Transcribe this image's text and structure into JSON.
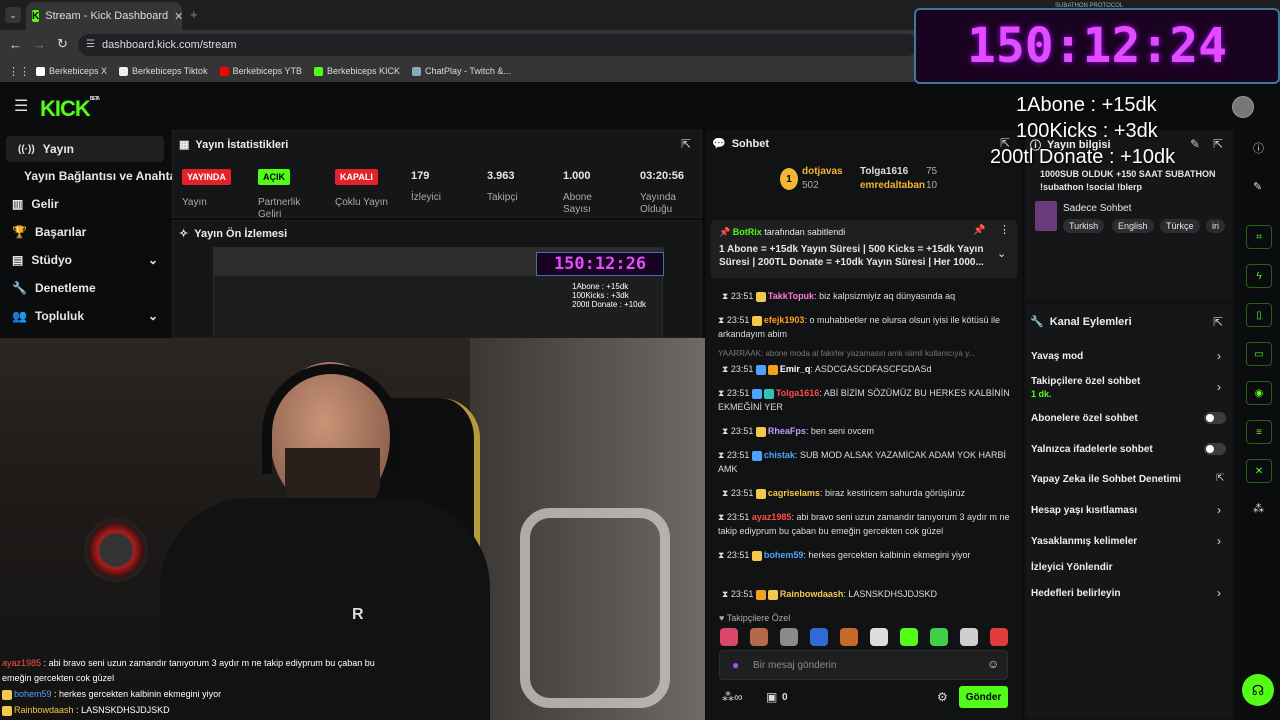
{
  "browser": {
    "tab_title": "Stream - Kick Dashboard",
    "url": "dashboard.kick.com/stream",
    "bookmarks": [
      {
        "label": "Berkebiceps X",
        "color": "#ffffff"
      },
      {
        "label": "Berkebiceps Tiktok",
        "color": "#ffffff"
      },
      {
        "label": "Berkebiceps YTB",
        "color": "#ff0000"
      },
      {
        "label": "Berkebiceps KICK",
        "color": "#53fc18"
      },
      {
        "label": "ChatPlay - Twitch &...",
        "color": "#9ab"
      }
    ]
  },
  "brand": {
    "logo": "KICK",
    "beta": "BETA",
    "accent": "#53fc18"
  },
  "sidebar": {
    "items": [
      {
        "label": "Yayın",
        "icon": "broadcast-icon"
      },
      {
        "label": "Yayın Bağlantısı ve Anahtarı",
        "icon": ""
      },
      {
        "label": "Gelir",
        "icon": "chart-icon"
      },
      {
        "label": "Başarılar",
        "icon": "trophy-icon"
      },
      {
        "label": "Stüdyo",
        "icon": "studio-icon"
      },
      {
        "label": "Denetleme",
        "icon": "wrench-icon"
      },
      {
        "label": "Topluluk",
        "icon": "community-icon"
      }
    ]
  },
  "stats": {
    "title": "Yayın İstatistikleri",
    "live_badge": "YAYINDA",
    "live_label": "Yayın",
    "partner_badge": "AÇIK",
    "partner_label": "Partnerlik Geliri",
    "multi_badge": "KAPALI",
    "multi_label": "Çoklu Yayın",
    "viewers_value": "179",
    "viewers_label": "İzleyici",
    "followers_value": "3.963",
    "followers_label": "Takipçi",
    "subs_value": "1.000",
    "subs_label": "Abone Sayısı",
    "uptime_value": "03:20:56",
    "uptime_label": "Yayında Olduğu"
  },
  "preview": {
    "title": "Yayın Ön İzlemesi"
  },
  "chat": {
    "title": "Sohbet",
    "gifter1_name": "dotjavas",
    "gifter1_count": "502",
    "gifter2_name": "Tolga1616",
    "gifter2_count": "75",
    "gifter3_name": "emredaltaban",
    "gifter3_count": "10",
    "pinned_by": "BotRix",
    "pinned_suffix": "tarafından sabitlendi",
    "pinned_text": "1 Abone = +15dk Yayın Süresi | 500 Kicks = +15dk Yayın Süresi | 200TL Donate = +10dk Yayın Süresi | Her 1000...",
    "messages": [
      {
        "time": "23:51",
        "user": "TakkTopuk",
        "color": "#ff7ad9",
        "text": "biz kalpsizmiyiz aq dünyasında aq"
      },
      {
        "time": "23:51",
        "user": "efejk1903",
        "color": "#ff9f1a",
        "text": "o muhabbetler ne olursa olsun iyisi ile kötüsü ile arkandayım abim"
      },
      {
        "time": "",
        "user": "YAARRAAK",
        "color": "#888888",
        "text": "abone moda al fakirler yazamasın amk isimli kullanıcıya y..."
      },
      {
        "time": "23:51",
        "user": "Emir_q",
        "color": "#ffffff",
        "text": "ASDCGASCDFASCFGDASd"
      },
      {
        "time": "23:51",
        "user": "Tolga1616",
        "color": "#ff4d4d",
        "text": "ABİ BİZİM SÖZÜMÜZ BU HERKES KALBİNİN EKMEĞİNİ YER"
      },
      {
        "time": "23:51",
        "user": "RheaFps",
        "color": "#c59aff",
        "text": "ben seni ovcem"
      },
      {
        "time": "23:51",
        "user": "chistak",
        "color": "#4ea3ff",
        "text": "SUB MOD ALSAK YAZAMİCAK ADAM YOK HARBİ AMK"
      },
      {
        "time": "23:51",
        "user": "cagriselams",
        "color": "#f2c94c",
        "text": "biraz kestiricem sahurda görüşürüz"
      },
      {
        "time": "23:51",
        "user": "ayaz1985",
        "color": "#ff4d4d",
        "text": "abi bravo seni uzun zamandır tanıyorum 3 aydır m ne takip ediyprum bu çaban bu emeğin gercekten cok güzel"
      },
      {
        "time": "23:51",
        "user": "bohem59",
        "color": "#4ea3ff",
        "text": "herkes gercekten kalbinin ekmegini yiyor"
      },
      {
        "time": "23:51",
        "user": "Rainbowdaash",
        "color": "#f2c94c",
        "text": "LASNSKDHSJDJSKD"
      }
    ],
    "followers_only": "Takipçilere Özel",
    "input_placeholder": "Bir mesaj gönderin",
    "kicks_count": "0",
    "send_label": "Gönder"
  },
  "info": {
    "title": "Yayın bilgisi",
    "stream_title": "1000SUB OLDUK +150 SAAT SUBATHON !subathon !social !blerp",
    "category": "Sadece Sohbet",
    "tags": [
      "Turkish",
      "English",
      "Türkçe",
      "iri"
    ]
  },
  "actions": {
    "title": "Kanal Eylemleri",
    "items": [
      {
        "label": "Yavaş mod",
        "sub": ""
      },
      {
        "label": "Takipçilere özel sohbet",
        "sub": "1 dk."
      },
      {
        "label": "Abonelere özel sohbet",
        "sub": ""
      },
      {
        "label": "Yalnızca ifadelerle sohbet",
        "sub": ""
      },
      {
        "label": "Yapay Zeka ile Sohbet Denetimi",
        "sub": ""
      },
      {
        "label": "Hesap yaşı kısıtlaması",
        "sub": ""
      },
      {
        "label": "Yasaklanmış kelimeler",
        "sub": ""
      },
      {
        "label": "İzleyici Yönlendir",
        "sub": ""
      },
      {
        "label": "Hedefleri belirleyin",
        "sub": ""
      }
    ]
  },
  "overlay": {
    "timer": "150:12:24",
    "timer_caption": "SUBATHON PROTOCOL",
    "line1": "1Abone : +15dk",
    "line2": "100Kicks : +3dk",
    "line3": "200tl Donate : +10dk"
  },
  "video_chat": [
    {
      "user": "ayaz1985",
      "color": "#ff4d4d",
      "text": "abi bravo seni uzun zamandır tanıyorum 3 aydır m ne takip ediyprum bu çaban bu emeğin gercekten cok güzel"
    },
    {
      "user": "bohem59",
      "color": "#4ea3ff",
      "text": "herkes gercekten kalbinin ekmegini yiyor"
    },
    {
      "user": "Rainbowdaash",
      "color": "#f2c94c",
      "text": "LASNSKDHSJDJSKD"
    }
  ]
}
